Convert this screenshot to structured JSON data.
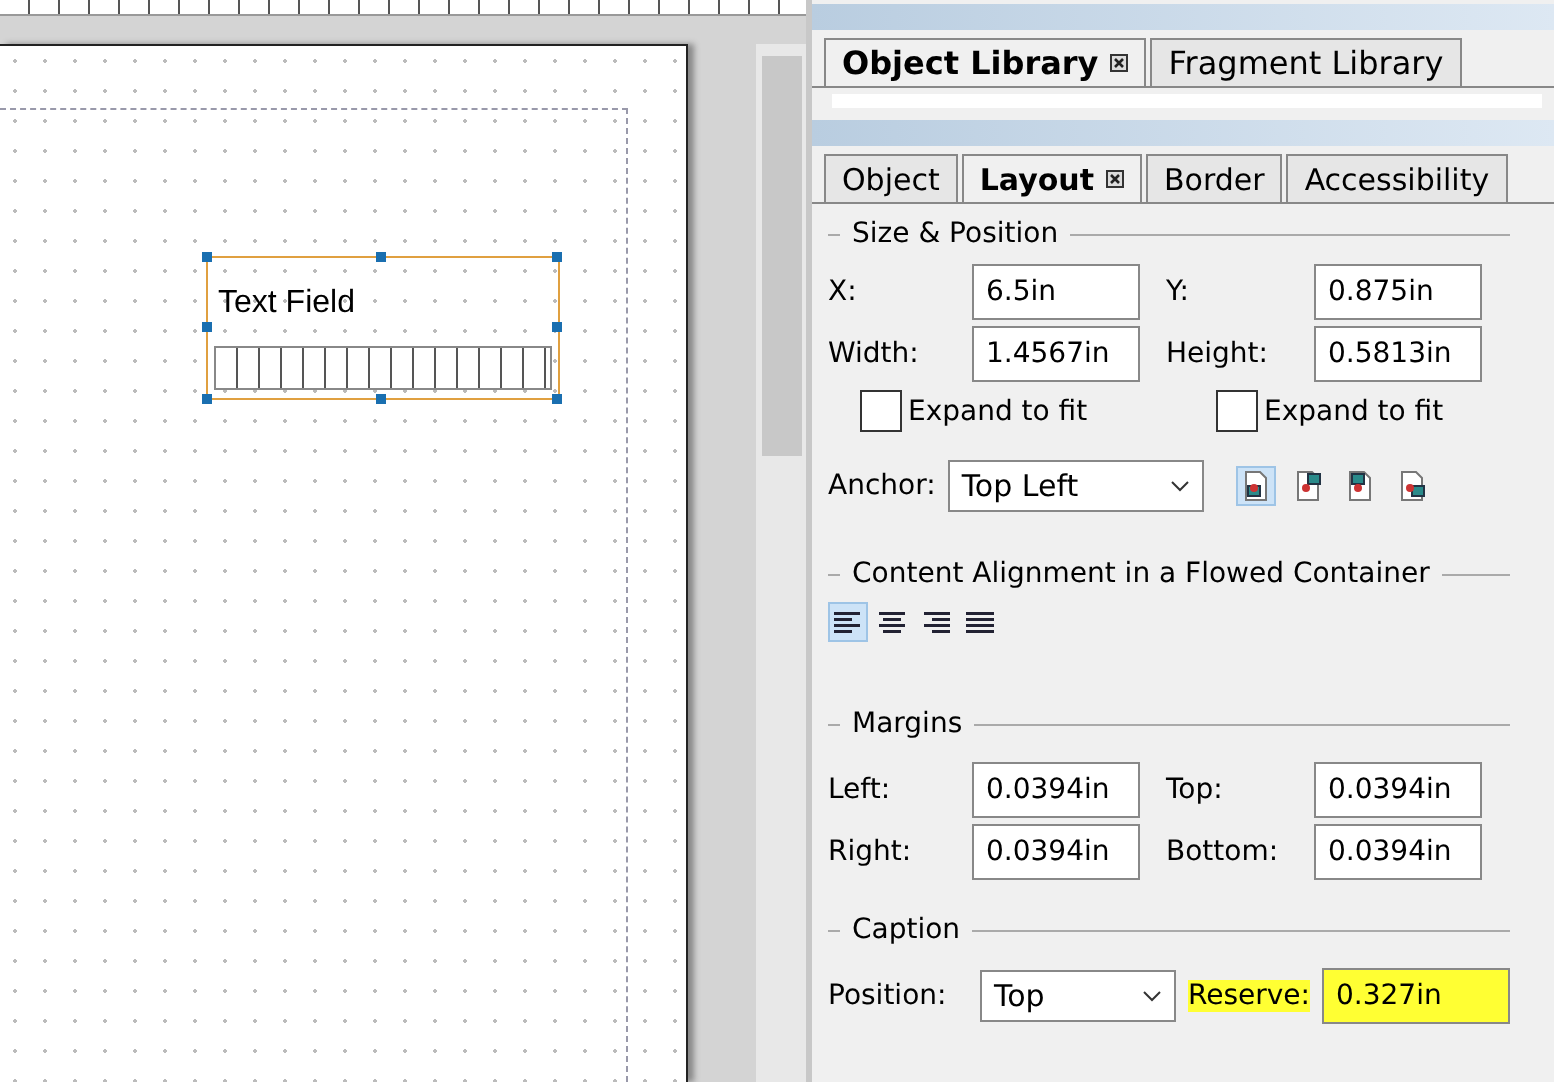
{
  "canvas": {
    "field": {
      "caption": "Text Field",
      "selected": true
    }
  },
  "library_panel": {
    "tabs": [
      {
        "label": "Object Library",
        "selected": true
      },
      {
        "label": "Fragment Library",
        "selected": false
      }
    ]
  },
  "object_panel": {
    "tabs": [
      {
        "label": "Object",
        "selected": false
      },
      {
        "label": "Layout",
        "selected": true
      },
      {
        "label": "Border",
        "selected": false
      },
      {
        "label": "Accessibility",
        "selected": false
      }
    ],
    "size_position": {
      "title": "Size & Position",
      "fields": [
        {
          "label": "X:",
          "value": "6.5in"
        },
        {
          "label": "Y:",
          "value": "0.875in"
        },
        {
          "label": "Width:",
          "value": "1.4567in"
        },
        {
          "label": "Height:",
          "value": "0.5813in"
        }
      ],
      "expand": [
        {
          "label": "Expand to fit",
          "checked": false
        },
        {
          "label": "Expand to fit",
          "checked": false
        }
      ]
    },
    "anchor": {
      "label": "Anchor:",
      "value": "Top Left",
      "buttons": [
        {
          "selected": true
        },
        {
          "selected": false
        },
        {
          "selected": false
        },
        {
          "selected": false
        }
      ]
    },
    "alignment": {
      "title": "Content Alignment in a Flowed Container",
      "buttons": [
        {
          "selected": true
        },
        {
          "selected": false
        },
        {
          "selected": false
        },
        {
          "selected": false
        }
      ]
    },
    "margins": {
      "title": "Margins",
      "fields": [
        {
          "label": "Left:",
          "value": "0.0394in"
        },
        {
          "label": "Top:",
          "value": "0.0394in"
        },
        {
          "label": "Right:",
          "value": "0.0394in"
        },
        {
          "label": "Bottom:",
          "value": "0.0394in"
        }
      ]
    },
    "caption": {
      "title": "Caption",
      "position_label": "Position:",
      "position": "Top",
      "reserve_label": "Reserve:",
      "reserve": "0.327in",
      "highlighted": true
    }
  }
}
